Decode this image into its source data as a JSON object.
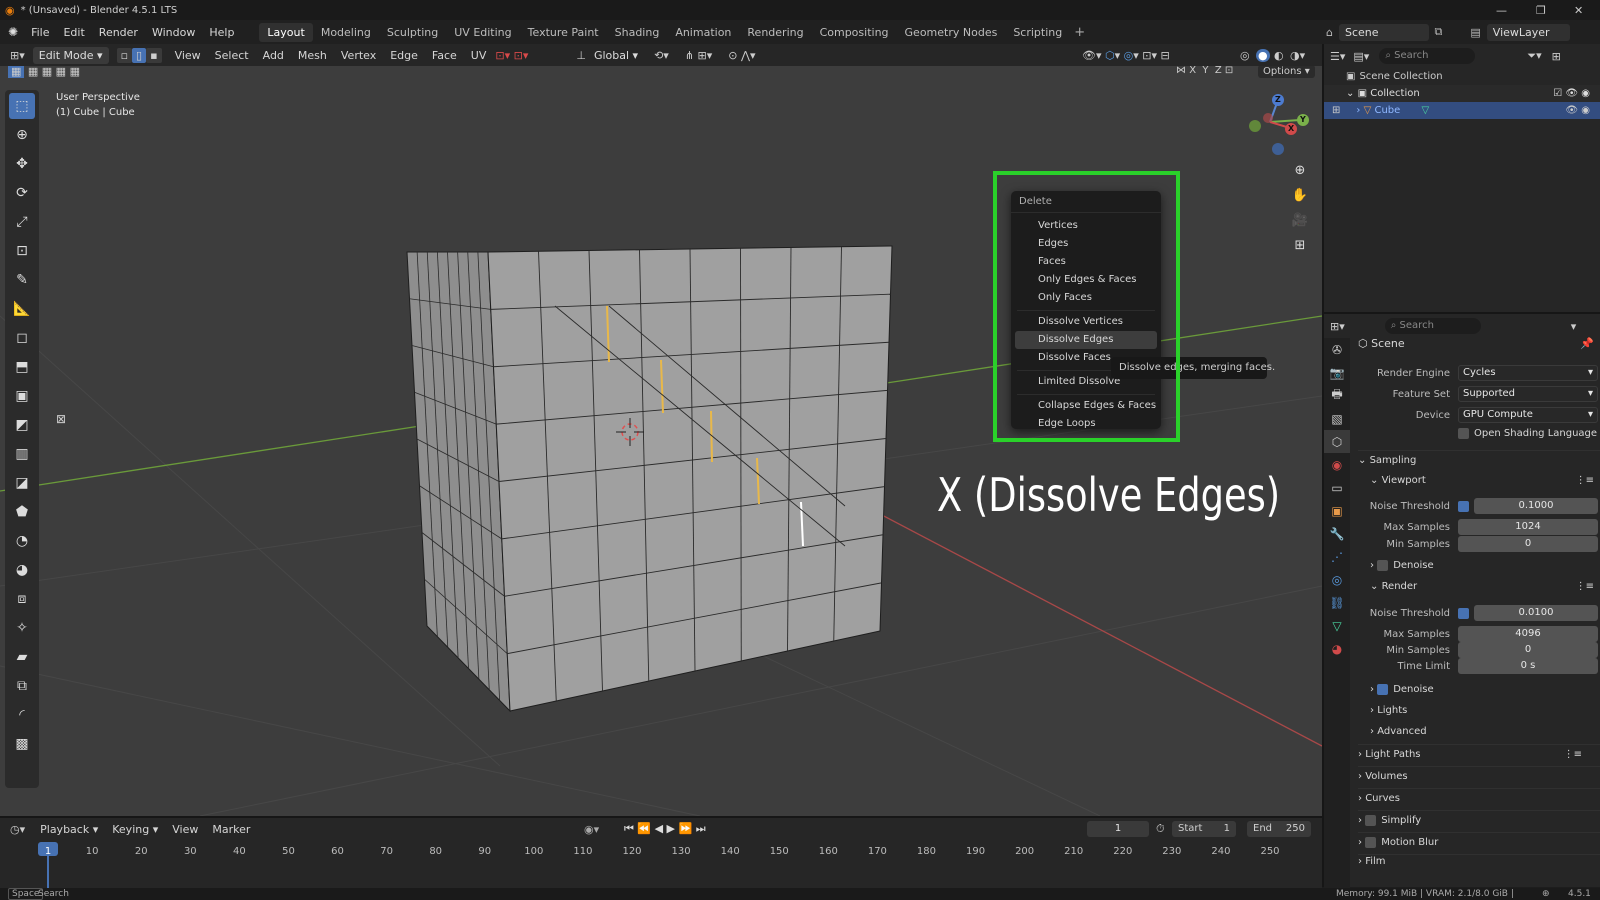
{
  "window": {
    "title": "* (Unsaved) - Blender 4.5.1 LTS"
  },
  "menubar": {
    "menus": [
      "File",
      "Edit",
      "Render",
      "Window",
      "Help"
    ],
    "workspaces": [
      "Layout",
      "Modeling",
      "Sculpting",
      "UV Editing",
      "Texture Paint",
      "Shading",
      "Animation",
      "Rendering",
      "Compositing",
      "Geometry Nodes",
      "Scripting"
    ],
    "active_workspace": "Layout",
    "scene_label": "Scene",
    "viewlayer_label": "ViewLayer"
  },
  "viewport_header": {
    "mode": "Edit Mode",
    "menus": [
      "View",
      "Select",
      "Add",
      "Mesh",
      "Vertex",
      "Edge",
      "Face",
      "UV"
    ],
    "orientation": "Global",
    "options_label": "Options",
    "axes": [
      "X",
      "Y",
      "Z"
    ]
  },
  "viewport": {
    "perspective": "User Perspective",
    "object_info": "(1) Cube | Cube",
    "gizmo_axes": {
      "z": "Z",
      "y": "Y",
      "x": "X"
    }
  },
  "delete_menu": {
    "title": "Delete",
    "items": [
      "Vertices",
      "Edges",
      "Faces",
      "Only Edges & Faces",
      "Only Faces",
      "Dissolve Vertices",
      "Dissolve Edges",
      "Dissolve Faces",
      "Limited Dissolve",
      "Collapse Edges & Faces",
      "Edge Loops"
    ],
    "highlighted": "Dissolve Edges",
    "tooltip": "Dissolve edges, merging faces.",
    "highlight_color": "#2ad12a"
  },
  "annotation": {
    "text": "X (Dissolve Edges)"
  },
  "outliner": {
    "search_placeholder": "Search",
    "scene_collection": "Scene Collection",
    "collection": "Collection",
    "object": "Cube"
  },
  "properties": {
    "search_placeholder": "Search",
    "context": "Scene",
    "render_engine_label": "Render Engine",
    "render_engine": "Cycles",
    "feature_set_label": "Feature Set",
    "feature_set": "Supported",
    "device_label": "Device",
    "device": "GPU Compute",
    "osl_label": "Open Shading Language",
    "sampling": "Sampling",
    "viewport": "Viewport",
    "noise_threshold_label": "Noise Threshold",
    "vp_noise_threshold": "0.1000",
    "max_samples_label": "Max Samples",
    "vp_max_samples": "1024",
    "min_samples_label": "Min Samples",
    "vp_min_samples": "0",
    "denoise": "Denoise",
    "render": "Render",
    "r_noise_threshold": "0.0100",
    "r_max_samples": "4096",
    "r_min_samples": "0",
    "time_limit_label": "Time Limit",
    "r_time_limit": "0 s",
    "lights": "Lights",
    "advanced": "Advanced",
    "light_paths": "Light Paths",
    "volumes": "Volumes",
    "curves": "Curves",
    "simplify": "Simplify",
    "motion_blur": "Motion Blur",
    "film": "Film"
  },
  "timeline": {
    "menus": [
      "Playback",
      "Keying",
      "View",
      "Marker"
    ],
    "current_frame": "1",
    "start_label": "Start",
    "start": "1",
    "end_label": "End",
    "end": "250",
    "ticks": [
      "1",
      "10",
      "20",
      "30",
      "40",
      "50",
      "60",
      "70",
      "80",
      "90",
      "100",
      "110",
      "120",
      "130",
      "140",
      "150",
      "160",
      "170",
      "180",
      "190",
      "200",
      "210",
      "220",
      "230",
      "240",
      "250"
    ]
  },
  "statusbar": {
    "key": "Space",
    "action": "Search",
    "memory": "Memory: 99.1 MiB | VRAM: 2.1/8.0 GiB |",
    "version": "4.5.1"
  }
}
